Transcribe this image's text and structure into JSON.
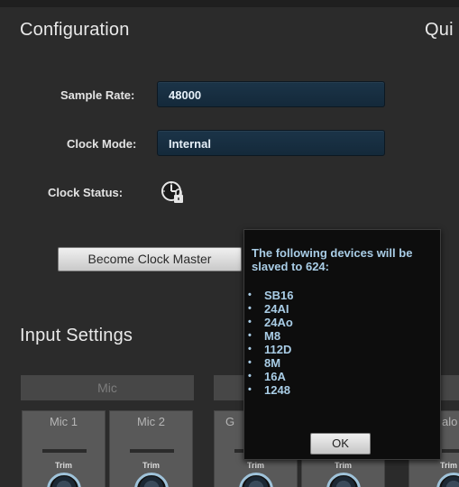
{
  "config": {
    "title": "Configuration",
    "quick_title_partial": "Qui",
    "sample_rate_label": "Sample Rate:",
    "sample_rate_value": "48000",
    "clock_mode_label": "Clock Mode:",
    "clock_mode_value": "Internal",
    "clock_status_label": "Clock Status:",
    "clock_status_icon": "clock-locked-icon",
    "become_clock_master_label": "Become Clock Master"
  },
  "input_settings": {
    "title": "Input Settings",
    "mic_group_label": "Mic",
    "channels": [
      {
        "name": "Mic 1",
        "trim_label": "Trim"
      },
      {
        "name": "Mic 2",
        "trim_label": "Trim"
      },
      {
        "name": "G",
        "trim_label": "Trim"
      },
      {
        "name": "",
        "trim_label": "Trim"
      },
      {
        "name": "alo",
        "trim_label": "Trim"
      }
    ]
  },
  "dialog": {
    "message": "The following devices will be slaved to 624:",
    "devices": [
      "SB16",
      "24AI",
      "24Ao",
      "M8",
      "112D",
      "8M",
      "16A",
      "1248"
    ],
    "ok_label": "OK"
  },
  "colors": {
    "background": "#2b2b2b",
    "field_bg": "#1b3448",
    "dialog_text": "#a9cde6",
    "knob_ring": "#9fc3da"
  }
}
